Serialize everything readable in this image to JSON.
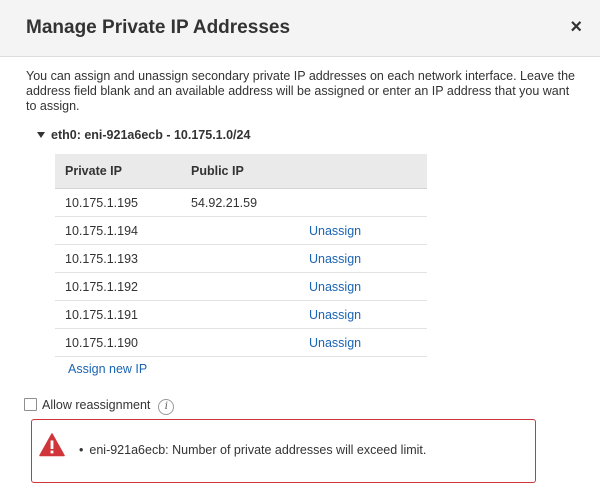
{
  "dialog": {
    "title": "Manage Private IP Addresses",
    "close_label": "×",
    "description": "You can assign and unassign secondary private IP addresses on each network interface. Leave the address field blank and an available address will be assigned or enter an IP address that you want to assign."
  },
  "interface": {
    "label": "eth0: eni-921a6ecb - 10.175.1.0/24"
  },
  "table": {
    "headers": [
      "Private IP",
      "Public IP",
      ""
    ],
    "rows": [
      {
        "private_ip": "10.175.1.195",
        "public_ip": "54.92.21.59",
        "action": ""
      },
      {
        "private_ip": "10.175.1.194",
        "public_ip": "",
        "action": "Unassign"
      },
      {
        "private_ip": "10.175.1.193",
        "public_ip": "",
        "action": "Unassign"
      },
      {
        "private_ip": "10.175.1.192",
        "public_ip": "",
        "action": "Unassign"
      },
      {
        "private_ip": "10.175.1.191",
        "public_ip": "",
        "action": "Unassign"
      },
      {
        "private_ip": "10.175.1.190",
        "public_ip": "",
        "action": "Unassign"
      }
    ]
  },
  "assign_new_label": "Assign new IP",
  "reassignment": {
    "label": "Allow reassignment",
    "checked": false,
    "info_icon": "info-icon"
  },
  "error": {
    "icon": "warning-icon",
    "message": "eni-921a6ecb: Number of private addresses will exceed limit.",
    "color": "#d0353a"
  },
  "colors": {
    "link": "#1a64b3",
    "header_bg": "#f4f4f4",
    "table_header_bg": "#eaeaea"
  }
}
